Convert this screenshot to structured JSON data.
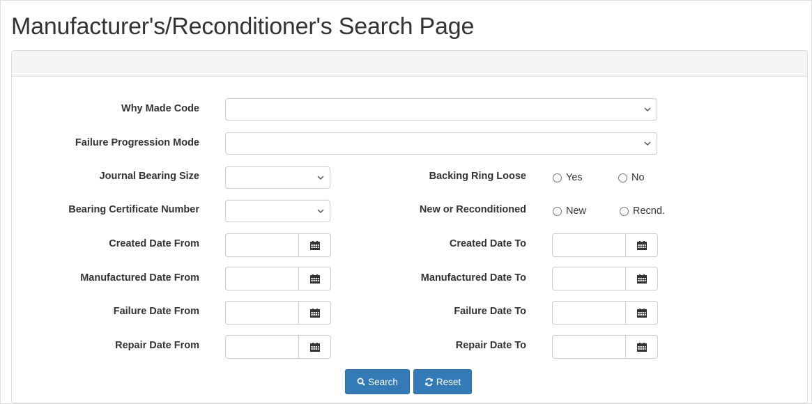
{
  "page": {
    "title": "Manufacturer's/Reconditioner's Search Page"
  },
  "form": {
    "why_made_code": {
      "label": "Why Made Code",
      "value": ""
    },
    "failure_progression_mode": {
      "label": "Failure Progression Mode",
      "value": ""
    },
    "journal_bearing_size": {
      "label": "Journal Bearing Size",
      "value": ""
    },
    "bearing_certificate_number": {
      "label": "Bearing Certificate Number",
      "value": ""
    },
    "backing_ring_loose": {
      "label": "Backing Ring Loose",
      "options": [
        "Yes",
        "No"
      ],
      "selected": null
    },
    "new_or_reconditioned": {
      "label": "New or Reconditioned",
      "options": [
        "New",
        "Recnd."
      ],
      "selected": null
    },
    "created_date_from": {
      "label": "Created Date From",
      "value": ""
    },
    "created_date_to": {
      "label": "Created Date To",
      "value": ""
    },
    "manufactured_date_from": {
      "label": "Manufactured Date From",
      "value": ""
    },
    "manufactured_date_to": {
      "label": "Manufactured Date To",
      "value": ""
    },
    "failure_date_from": {
      "label": "Failure Date From",
      "value": ""
    },
    "failure_date_to": {
      "label": "Failure Date To",
      "value": ""
    },
    "repair_date_from": {
      "label": "Repair Date From",
      "value": ""
    },
    "repair_date_to": {
      "label": "Repair Date To",
      "value": ""
    }
  },
  "actions": {
    "search_label": "Search",
    "reset_label": "Reset"
  },
  "icons": {
    "calendar": "calendar-icon",
    "chevron": "chevron-down-icon",
    "search": "search-icon",
    "reset": "refresh-icon"
  },
  "colors": {
    "primary_button": "#337ab7",
    "panel_heading": "#f5f5f5",
    "border": "#cccccc"
  }
}
